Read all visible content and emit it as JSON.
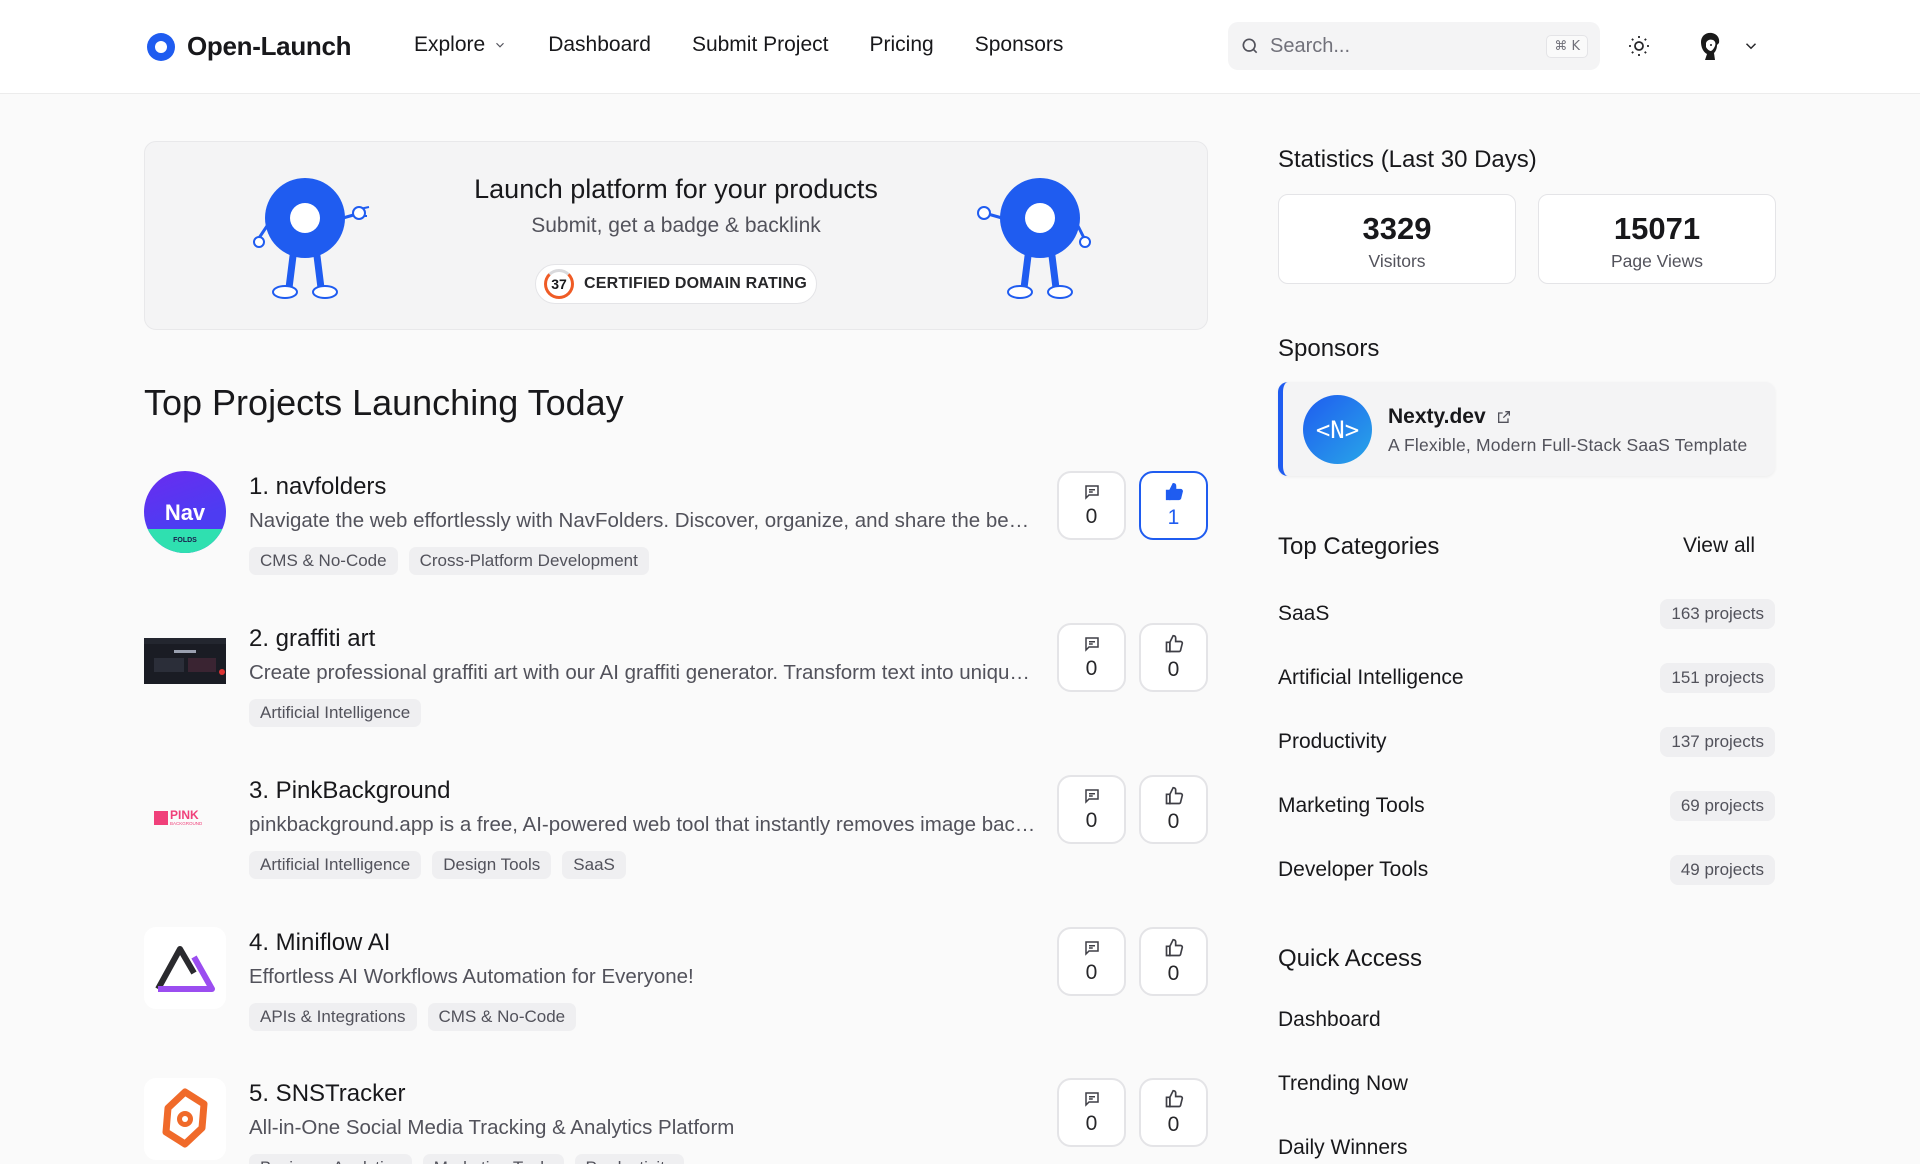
{
  "header": {
    "logo_text": "Open-Launch",
    "nav": [
      "Explore",
      "Dashboard",
      "Submit Project",
      "Pricing",
      "Sponsors"
    ],
    "search_placeholder": "Search...",
    "search_shortcut": "⌘ K"
  },
  "hero": {
    "title": "Launch platform for your products",
    "subtitle": "Submit, get a badge & backlink",
    "badge_number": "37",
    "badge_text": "CERTIFIED DOMAIN RATING"
  },
  "main": {
    "section_title": "Top Projects Launching Today",
    "projects": [
      {
        "name": "1. navfolders",
        "description": "Navigate the web effortlessly with NavFolders. Discover, organize, and share the best websites with ease.",
        "tags": [
          "CMS & No-Code",
          "Cross-Platform Development"
        ],
        "comments": "0",
        "upvotes": "1",
        "upvoted": true,
        "logo_text": "Nav",
        "logo_subtext": "FOLDS"
      },
      {
        "name": "2. graffiti art",
        "description": "Create professional graffiti art with our AI graffiti generator. Transform text into unique graffiti designs.",
        "tags": [
          "Artificial Intelligence"
        ],
        "comments": "0",
        "upvotes": "0",
        "upvoted": false
      },
      {
        "name": "3. PinkBackground",
        "description": "pinkbackground.app is a free, AI-powered web tool that instantly removes image backgrounds.",
        "tags": [
          "Artificial Intelligence",
          "Design Tools",
          "SaaS"
        ],
        "comments": "0",
        "upvotes": "0",
        "upvoted": false,
        "logo_text": "PINK",
        "logo_subtext": "BACKGROUND"
      },
      {
        "name": "4. Miniflow AI",
        "description": "Effortless AI Workflows Automation for Everyone!",
        "tags": [
          "APIs & Integrations",
          "CMS & No-Code"
        ],
        "comments": "0",
        "upvotes": "0",
        "upvoted": false
      },
      {
        "name": "5. SNSTracker",
        "description": "All-in-One Social Media Tracking & Analytics Platform",
        "tags": [
          "Business Analytics",
          "Marketing Tools",
          "Productivity"
        ],
        "comments": "0",
        "upvotes": "0",
        "upvoted": false
      }
    ]
  },
  "sidebar": {
    "stats_title": "Statistics (Last 30 Days)",
    "stats": [
      {
        "value": "3329",
        "label": "Visitors"
      },
      {
        "value": "15071",
        "label": "Page Views"
      }
    ],
    "sponsors_title": "Sponsors",
    "sponsor": {
      "logo_text": "<N>",
      "name": "Nexty.dev",
      "description": "A Flexible, Modern Full-Stack SaaS Template"
    },
    "categories_title": "Top Categories",
    "view_all": "View all",
    "categories": [
      {
        "name": "SaaS",
        "count": "163 projects"
      },
      {
        "name": "Artificial Intelligence",
        "count": "151 projects"
      },
      {
        "name": "Productivity",
        "count": "137 projects"
      },
      {
        "name": "Marketing Tools",
        "count": "69 projects"
      },
      {
        "name": "Developer Tools",
        "count": "49 projects"
      }
    ],
    "quick_access_title": "Quick Access",
    "quick_access": [
      "Dashboard",
      "Trending Now",
      "Daily Winners"
    ]
  },
  "colors": {
    "accent": "#1f5cf0",
    "background": "#fafafa",
    "muted_text": "#52525b"
  }
}
